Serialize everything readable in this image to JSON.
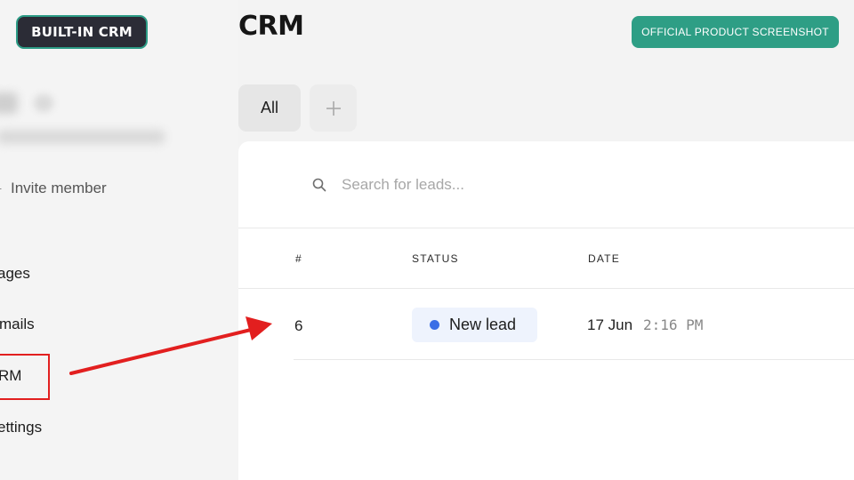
{
  "badges": {
    "built_in": "BUILT-IN CRM",
    "official": "OFFICIAL PRODUCT SCREENSHOT"
  },
  "sidebar": {
    "invite_label": "Invite member",
    "nav": [
      {
        "label": "ages"
      },
      {
        "label": "mails"
      },
      {
        "label": "RM"
      },
      {
        "label": "ettings"
      }
    ]
  },
  "header": {
    "title": "CRM"
  },
  "tabs": {
    "all_label": "All",
    "add_icon": "plus-icon"
  },
  "search": {
    "icon": "search-icon",
    "placeholder": "Search for leads..."
  },
  "table": {
    "columns": [
      "#",
      "STATUS",
      "DATE"
    ],
    "rows": [
      {
        "number": "6",
        "status": "New lead",
        "date": "17 Jun",
        "time": "2:16 PM"
      }
    ]
  },
  "colors": {
    "accent_teal": "#2e9e85",
    "dark_badge": "#2b2c36",
    "status_dot": "#3b6ee6",
    "annotation_red": "#e21f1f"
  }
}
